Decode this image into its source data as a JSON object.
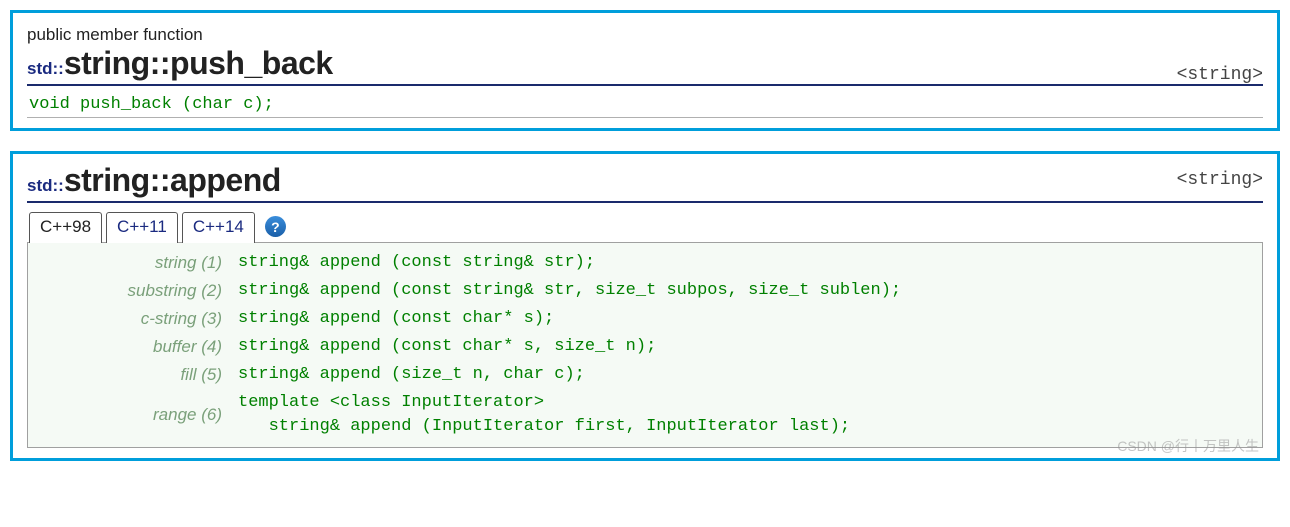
{
  "panel1": {
    "subtitle": "public member function",
    "ns": "std::",
    "name": "string::push_back",
    "header": "<string>",
    "signature": "void push_back (char c);"
  },
  "panel2": {
    "ns": "std::",
    "name": "string::append",
    "header": "<string>",
    "tabs": [
      "C++98",
      "C++11",
      "C++14"
    ],
    "help": "?",
    "overloads": [
      {
        "label": "string (1)",
        "sig": "string& append (const string& str);"
      },
      {
        "label": "substring (2)",
        "sig": "string& append (const string& str, size_t subpos, size_t sublen);"
      },
      {
        "label": "c-string (3)",
        "sig": "string& append (const char* s);"
      },
      {
        "label": "buffer (4)",
        "sig": "string& append (const char* s, size_t n);"
      },
      {
        "label": "fill (5)",
        "sig": "string& append (size_t n, char c);"
      },
      {
        "label": "range (6)",
        "sig": "template <class InputIterator>\n   string& append (InputIterator first, InputIterator last);"
      }
    ]
  },
  "watermark": "CSDN @行丨万里人生"
}
